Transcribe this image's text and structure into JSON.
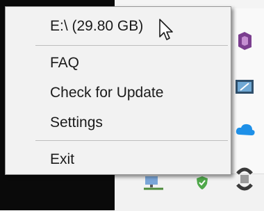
{
  "context_menu": {
    "drive_item": "E:\\ (29.80 GB)",
    "items": [
      {
        "label": "FAQ"
      },
      {
        "label": "Check for Update"
      },
      {
        "label": "Settings"
      }
    ],
    "exit_label": "Exit"
  },
  "tray_icons": [
    "generic-app-icon",
    "screen-app-icon",
    "cloud-icon",
    "network-icon",
    "shield-check-icon",
    "sync-icon"
  ],
  "colors": {
    "menu_background": "#f2f2f2",
    "menu_border": "#979797",
    "separator": "#bdbdbd",
    "text": "#1a1a1a"
  }
}
